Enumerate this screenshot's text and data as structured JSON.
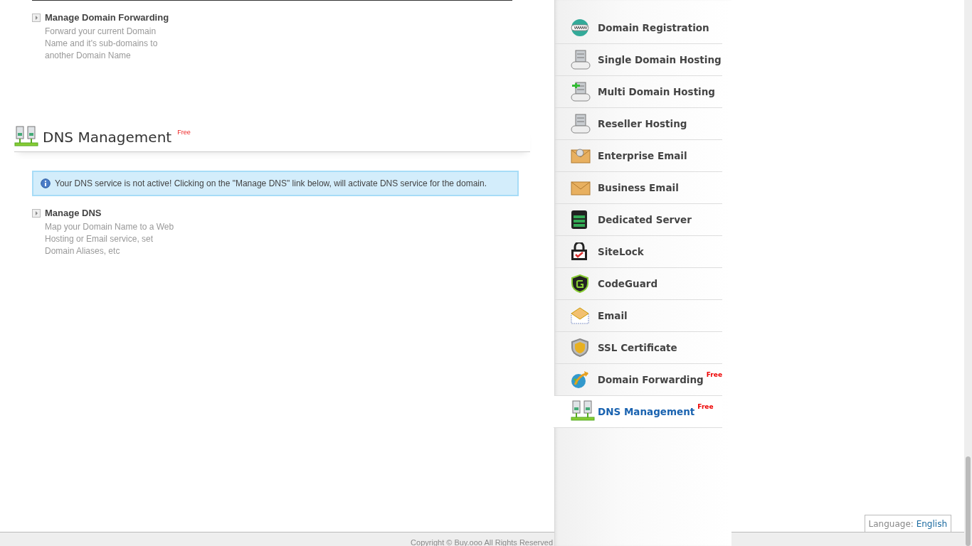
{
  "sections": [
    {
      "links": [
        {
          "title": "Manage Domain Forwarding",
          "description": [
            "Forward your current Domain",
            "Name and it's sub-domains to",
            "another Domain Name"
          ]
        }
      ]
    },
    {
      "heading": "DNS Management",
      "badge": "Free",
      "notice": "Your DNS service is not active! Clicking on the \"Manage DNS\" link below, will activate DNS service for the domain.",
      "links": [
        {
          "title": "Manage DNS",
          "description": [
            "Map your Domain Name to a Web",
            "Hosting or Email service, set",
            "Domain Aliases, etc"
          ]
        }
      ]
    }
  ],
  "sidebar": {
    "items": [
      {
        "label": "Domain Registration",
        "selected": false
      },
      {
        "label": "Single Domain Hosting",
        "selected": false
      },
      {
        "label": "Multi Domain Hosting",
        "selected": false
      },
      {
        "label": "Reseller Hosting",
        "selected": false
      },
      {
        "label": "Enterprise Email",
        "selected": false
      },
      {
        "label": "Business Email",
        "selected": false
      },
      {
        "label": "Dedicated Server",
        "selected": false
      },
      {
        "label": "SiteLock",
        "selected": false
      },
      {
        "label": "CodeGuard",
        "selected": false
      },
      {
        "label": "Email",
        "selected": false
      },
      {
        "label": "SSL Certificate",
        "selected": false
      },
      {
        "label": "Domain Forwarding",
        "badge": "Free",
        "selected": false
      },
      {
        "label": "DNS Management",
        "badge": "Free",
        "selected": true
      }
    ]
  },
  "language": {
    "label": "Language:",
    "value": "English"
  },
  "footer": {
    "copyright": "Copyright © Buy.ooo All Rights Reserved"
  }
}
